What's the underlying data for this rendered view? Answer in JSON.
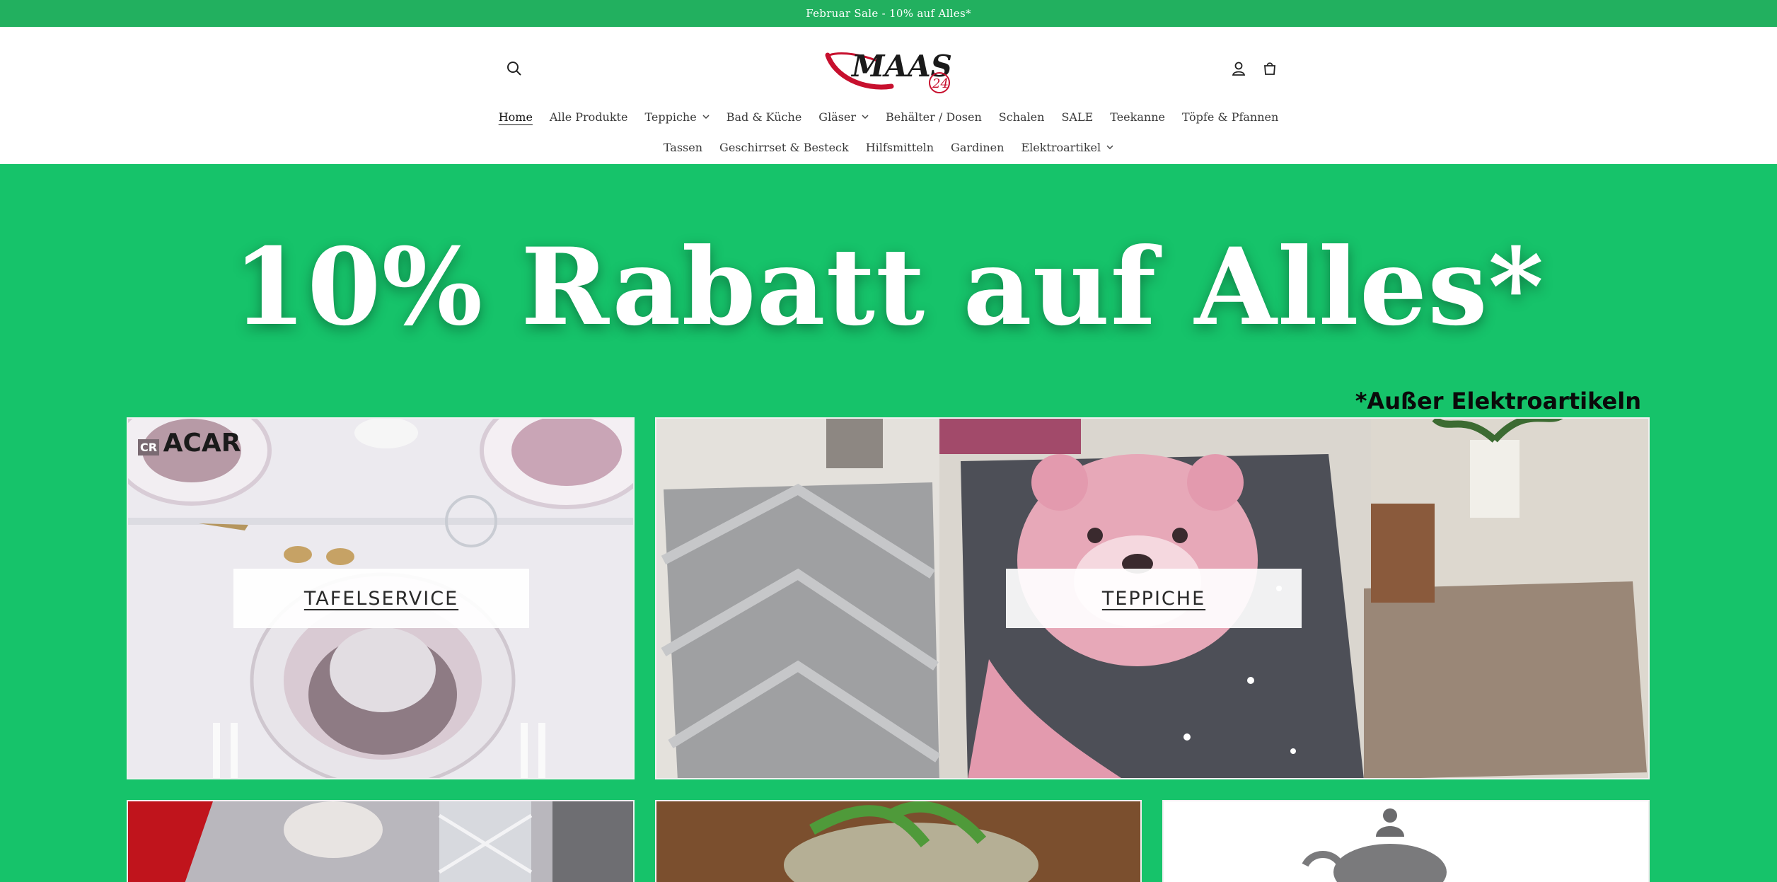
{
  "announcement": "Februar Sale - 10% auf Alles*",
  "header": {
    "logo_text": "MAAS",
    "logo_badge": "24",
    "icons": {
      "search": "search-icon",
      "account": "account-icon",
      "cart": "cart-icon"
    }
  },
  "nav": {
    "row1": [
      {
        "label": "Home",
        "active": true,
        "dropdown": false
      },
      {
        "label": "Alle Produkte",
        "dropdown": false
      },
      {
        "label": "Teppiche",
        "dropdown": true
      },
      {
        "label": "Bad & Küche",
        "dropdown": false
      },
      {
        "label": "Gläser",
        "dropdown": true
      },
      {
        "label": "Behälter / Dosen",
        "dropdown": false
      },
      {
        "label": "Schalen",
        "dropdown": false
      },
      {
        "label": "SALE",
        "dropdown": false
      },
      {
        "label": "Teekanne",
        "dropdown": false
      },
      {
        "label": "Töpfe & Pfannen",
        "dropdown": false
      }
    ],
    "row2": [
      {
        "label": "Tassen",
        "dropdown": false
      },
      {
        "label": "Geschirrset & Besteck",
        "dropdown": false
      },
      {
        "label": "Hilfsmitteln",
        "dropdown": false
      },
      {
        "label": "Gardinen",
        "dropdown": false
      },
      {
        "label": "Elektroartikel",
        "dropdown": true
      }
    ]
  },
  "hero": {
    "title": "10% Rabatt auf Alles*",
    "note": "*Außer Elektroartikeln"
  },
  "tiles": {
    "tafelservice": {
      "label": "TAFELSERVICE",
      "brand": "ACAR",
      "brand_prefix": "CR"
    },
    "teppiche": {
      "label": "TEPPICHE"
    }
  },
  "colors": {
    "announcement_bg": "#22b05f",
    "hero_bg": "#16c36a"
  }
}
